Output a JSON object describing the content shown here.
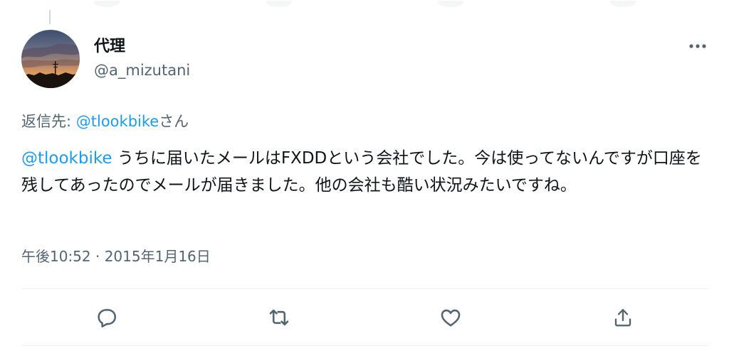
{
  "tweet": {
    "display_name": "代理",
    "handle": "@a_mizutani",
    "reply_prefix": "返信先: ",
    "reply_mention": "@tlookbike",
    "reply_suffix": "さん",
    "mention": "@tlookbike",
    "body": " うちに届いたメールはFXDDという会社でした。今は使ってないんですが口座を残してあったのでメールが届きました。他の会社も酷い状況みたいですね。",
    "timestamp": "午後10:52 · 2015年1月16日"
  },
  "icons": {
    "more": "more-horizontal-icon",
    "reply": "reply-bubble-icon",
    "retweet": "retweet-icon",
    "like": "heart-icon",
    "share": "share-icon"
  },
  "colors": {
    "link": "#1d9bf0",
    "secondary_text": "#536471",
    "primary_text": "#0f1419",
    "divider": "#eff3f4"
  }
}
